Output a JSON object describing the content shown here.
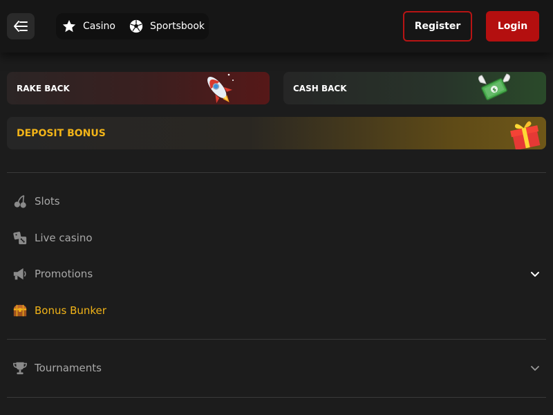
{
  "header": {
    "nav": [
      {
        "label": "Casino",
        "icon": "star-icon"
      },
      {
        "label": "Sportsbook",
        "icon": "soccer-ball-icon"
      }
    ],
    "register_label": "Register",
    "login_label": "Login"
  },
  "promos": {
    "rake_back": {
      "label": "RAKE BACK",
      "icon": "rocket-icon"
    },
    "cash_back": {
      "label": "CASH BACK",
      "icon": "flying-money-icon"
    },
    "deposit_bonus": {
      "label": "DEPOSIT BONUS",
      "icon": "gift-box-icon"
    }
  },
  "menu": {
    "items": [
      {
        "label": "Slots",
        "icon": "cherry-icon"
      },
      {
        "label": "Live casino",
        "icon": "dice-icon"
      },
      {
        "label": "Promotions",
        "icon": "megaphone-icon",
        "expandable": true
      },
      {
        "label": "Bonus Bunker",
        "icon": "treasure-chest-icon",
        "active": true
      }
    ],
    "tournaments": {
      "label": "Tournaments",
      "icon": "trophy-icon",
      "expandable": true
    }
  },
  "colors": {
    "accent_red": "#b40f0f",
    "accent_gold": "#f2b418",
    "background": "#1c1c1c"
  }
}
